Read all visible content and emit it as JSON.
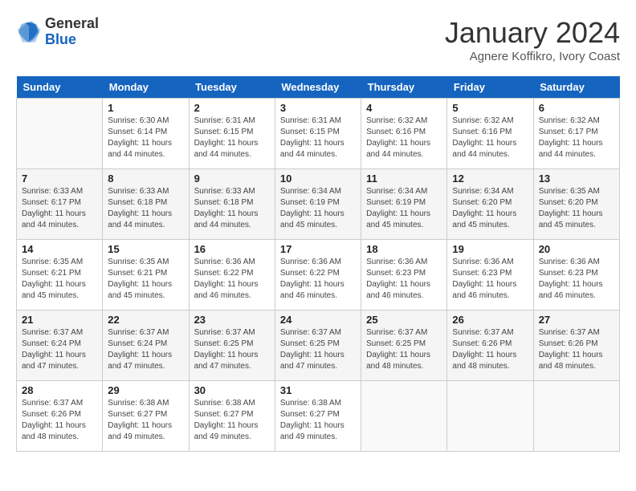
{
  "header": {
    "logo_general": "General",
    "logo_blue": "Blue",
    "month_title": "January 2024",
    "subtitle": "Agnere Koffikro, Ivory Coast"
  },
  "days_of_week": [
    "Sunday",
    "Monday",
    "Tuesday",
    "Wednesday",
    "Thursday",
    "Friday",
    "Saturday"
  ],
  "weeks": [
    [
      {
        "day": "",
        "info": ""
      },
      {
        "day": "1",
        "info": "Sunrise: 6:30 AM\nSunset: 6:14 PM\nDaylight: 11 hours\nand 44 minutes."
      },
      {
        "day": "2",
        "info": "Sunrise: 6:31 AM\nSunset: 6:15 PM\nDaylight: 11 hours\nand 44 minutes."
      },
      {
        "day": "3",
        "info": "Sunrise: 6:31 AM\nSunset: 6:15 PM\nDaylight: 11 hours\nand 44 minutes."
      },
      {
        "day": "4",
        "info": "Sunrise: 6:32 AM\nSunset: 6:16 PM\nDaylight: 11 hours\nand 44 minutes."
      },
      {
        "day": "5",
        "info": "Sunrise: 6:32 AM\nSunset: 6:16 PM\nDaylight: 11 hours\nand 44 minutes."
      },
      {
        "day": "6",
        "info": "Sunrise: 6:32 AM\nSunset: 6:17 PM\nDaylight: 11 hours\nand 44 minutes."
      }
    ],
    [
      {
        "day": "7",
        "info": "Sunrise: 6:33 AM\nSunset: 6:17 PM\nDaylight: 11 hours\nand 44 minutes."
      },
      {
        "day": "8",
        "info": "Sunrise: 6:33 AM\nSunset: 6:18 PM\nDaylight: 11 hours\nand 44 minutes."
      },
      {
        "day": "9",
        "info": "Sunrise: 6:33 AM\nSunset: 6:18 PM\nDaylight: 11 hours\nand 44 minutes."
      },
      {
        "day": "10",
        "info": "Sunrise: 6:34 AM\nSunset: 6:19 PM\nDaylight: 11 hours\nand 45 minutes."
      },
      {
        "day": "11",
        "info": "Sunrise: 6:34 AM\nSunset: 6:19 PM\nDaylight: 11 hours\nand 45 minutes."
      },
      {
        "day": "12",
        "info": "Sunrise: 6:34 AM\nSunset: 6:20 PM\nDaylight: 11 hours\nand 45 minutes."
      },
      {
        "day": "13",
        "info": "Sunrise: 6:35 AM\nSunset: 6:20 PM\nDaylight: 11 hours\nand 45 minutes."
      }
    ],
    [
      {
        "day": "14",
        "info": "Sunrise: 6:35 AM\nSunset: 6:21 PM\nDaylight: 11 hours\nand 45 minutes."
      },
      {
        "day": "15",
        "info": "Sunrise: 6:35 AM\nSunset: 6:21 PM\nDaylight: 11 hours\nand 45 minutes."
      },
      {
        "day": "16",
        "info": "Sunrise: 6:36 AM\nSunset: 6:22 PM\nDaylight: 11 hours\nand 46 minutes."
      },
      {
        "day": "17",
        "info": "Sunrise: 6:36 AM\nSunset: 6:22 PM\nDaylight: 11 hours\nand 46 minutes."
      },
      {
        "day": "18",
        "info": "Sunrise: 6:36 AM\nSunset: 6:23 PM\nDaylight: 11 hours\nand 46 minutes."
      },
      {
        "day": "19",
        "info": "Sunrise: 6:36 AM\nSunset: 6:23 PM\nDaylight: 11 hours\nand 46 minutes."
      },
      {
        "day": "20",
        "info": "Sunrise: 6:36 AM\nSunset: 6:23 PM\nDaylight: 11 hours\nand 46 minutes."
      }
    ],
    [
      {
        "day": "21",
        "info": "Sunrise: 6:37 AM\nSunset: 6:24 PM\nDaylight: 11 hours\nand 47 minutes."
      },
      {
        "day": "22",
        "info": "Sunrise: 6:37 AM\nSunset: 6:24 PM\nDaylight: 11 hours\nand 47 minutes."
      },
      {
        "day": "23",
        "info": "Sunrise: 6:37 AM\nSunset: 6:25 PM\nDaylight: 11 hours\nand 47 minutes."
      },
      {
        "day": "24",
        "info": "Sunrise: 6:37 AM\nSunset: 6:25 PM\nDaylight: 11 hours\nand 47 minutes."
      },
      {
        "day": "25",
        "info": "Sunrise: 6:37 AM\nSunset: 6:25 PM\nDaylight: 11 hours\nand 48 minutes."
      },
      {
        "day": "26",
        "info": "Sunrise: 6:37 AM\nSunset: 6:26 PM\nDaylight: 11 hours\nand 48 minutes."
      },
      {
        "day": "27",
        "info": "Sunrise: 6:37 AM\nSunset: 6:26 PM\nDaylight: 11 hours\nand 48 minutes."
      }
    ],
    [
      {
        "day": "28",
        "info": "Sunrise: 6:37 AM\nSunset: 6:26 PM\nDaylight: 11 hours\nand 48 minutes."
      },
      {
        "day": "29",
        "info": "Sunrise: 6:38 AM\nSunset: 6:27 PM\nDaylight: 11 hours\nand 49 minutes."
      },
      {
        "day": "30",
        "info": "Sunrise: 6:38 AM\nSunset: 6:27 PM\nDaylight: 11 hours\nand 49 minutes."
      },
      {
        "day": "31",
        "info": "Sunrise: 6:38 AM\nSunset: 6:27 PM\nDaylight: 11 hours\nand 49 minutes."
      },
      {
        "day": "",
        "info": ""
      },
      {
        "day": "",
        "info": ""
      },
      {
        "day": "",
        "info": ""
      }
    ]
  ]
}
